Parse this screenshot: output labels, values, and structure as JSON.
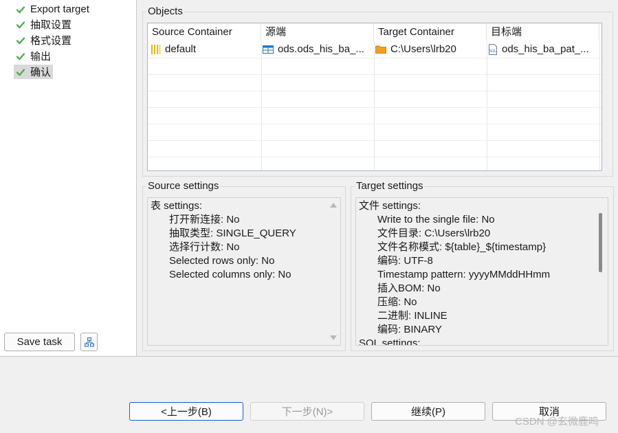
{
  "nav": {
    "items": [
      {
        "label": "Export target"
      },
      {
        "label": "抽取设置"
      },
      {
        "label": "格式设置"
      },
      {
        "label": "输出"
      },
      {
        "label": "确认"
      }
    ],
    "save_task_label": "Save task"
  },
  "objects": {
    "group_title": "Objects",
    "columns": [
      "Source Container",
      "源端",
      "Target Container",
      "目标端"
    ],
    "rows": [
      [
        "default",
        "ods.ods_his_ba_...",
        "C:\\Users\\lrb20",
        "ods_his_ba_pat_..."
      ]
    ]
  },
  "source_settings": {
    "title": "Source settings",
    "lines": [
      "表 settings:",
      "打开新连接: No",
      "抽取类型: SINGLE_QUERY",
      "选择行计数: No",
      "Selected rows only: No",
      "Selected columns only: No"
    ]
  },
  "target_settings": {
    "title": "Target settings",
    "lines": [
      "文件 settings:",
      "Write to the single file: No",
      "文件目录: C:\\Users\\lrb20",
      "文件名称模式: ${table}_${timestamp}",
      "编码: UTF-8",
      "Timestamp pattern: yyyyMMddHHmm",
      "插入BOM: No",
      "压缩: No",
      "二进制: INLINE",
      "编码: BINARY",
      "SQL settings:"
    ]
  },
  "buttons": {
    "back": "<上一步(B)",
    "next": "下一步(N)>",
    "continue": "继续(P)",
    "cancel": "取消"
  },
  "watermark": "CSDN @玄微鹿鸣",
  "colors": {
    "check": "#4caf50",
    "primary_border": "#0a64c8"
  }
}
